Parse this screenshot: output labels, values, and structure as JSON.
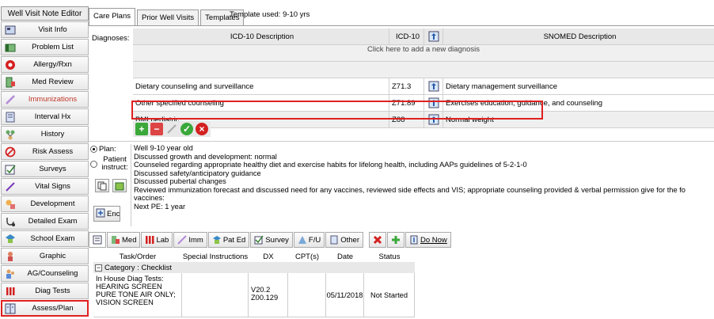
{
  "sidebar": {
    "title": "Well Visit Note Editor",
    "items": [
      {
        "label": "Visit Info",
        "icon": "visit-info-icon",
        "style": "normal"
      },
      {
        "label": "Problem List",
        "icon": "problem-list-icon",
        "style": "normal"
      },
      {
        "label": "Allergy/Rxn",
        "icon": "allergy-icon",
        "style": "normal"
      },
      {
        "label": "Med Review",
        "icon": "med-review-icon",
        "style": "normal"
      },
      {
        "label": "Immunizations",
        "icon": "syringe-icon",
        "style": "red"
      },
      {
        "label": "Interval Hx",
        "icon": "document-icon",
        "style": "normal"
      },
      {
        "label": "History",
        "icon": "family-tree-icon",
        "style": "normal"
      },
      {
        "label": "Risk Assess",
        "icon": "prohibited-icon",
        "style": "normal"
      },
      {
        "label": "Surveys",
        "icon": "survey-icon",
        "style": "normal"
      },
      {
        "label": "Vital Signs",
        "icon": "pencil-icon",
        "style": "normal"
      },
      {
        "label": "Development",
        "icon": "development-icon",
        "style": "normal"
      },
      {
        "label": "Detailed Exam",
        "icon": "stethoscope-icon",
        "style": "normal"
      },
      {
        "label": "School Exam",
        "icon": "school-icon",
        "style": "normal"
      },
      {
        "label": "Graphic",
        "icon": "graphic-icon",
        "style": "normal"
      },
      {
        "label": "AG/Counseling",
        "icon": "counseling-icon",
        "style": "normal"
      },
      {
        "label": "Diag Tests",
        "icon": "test-tubes-icon",
        "style": "normal"
      },
      {
        "label": "Assess/Plan",
        "icon": "assess-plan-icon",
        "style": "normal"
      }
    ]
  },
  "tabs": [
    "Care Plans",
    "Prior Well Visits",
    "Templates"
  ],
  "template_used": "Template used:  9-10 yrs",
  "diagnoses": {
    "label": "Diagnoses:",
    "headers": {
      "desc": "ICD-10 Description",
      "code": "ICD-10",
      "snomed": "SNOMED Description"
    },
    "add_text": "Click here to add a new diagnosis",
    "rows": [
      {
        "desc": "Dietary counseling and surveillance",
        "code": "Z71.3",
        "snomed": "Dietary management surveillance"
      },
      {
        "desc": "Other specified counseling",
        "code": "Z71.89",
        "snomed": "Exercises education, guidance, and counseling"
      },
      {
        "desc": "BMI pediatric",
        "code": "Z68",
        "snomed": "Normal weight"
      }
    ]
  },
  "plan": {
    "radio_plan": "Plan:",
    "radio_patient": "Patient instruct:",
    "enc_label": "Enc",
    "lines": [
      "Well 9-10 year old",
      "Discussed growth and development: normal",
      "Counseled regarding appropriate healthy diet and exercise habits for lifelong health, including AAPs guidelines of 5-2-1-0",
      "Discussed safety/anticipatory guidance",
      "Discussed pubertal changes",
      "Reviewed immunization forecast and discussed need for any vaccines, reviewed side effects and VIS;  appropriate counseling provided & verbal permission give for the fo",
      "vaccines:",
      "Next PE: 1 year"
    ]
  },
  "bottom_tabs": [
    "Med",
    "Lab",
    "Imm",
    "Pat Ed",
    "Survey",
    "F/U",
    "Other"
  ],
  "do_now": "Do Now",
  "orders": {
    "headers": [
      "Task/Order",
      "Special Instructions",
      "DX",
      "CPT(s)",
      "Date",
      "Status"
    ],
    "category": "Category : Checklist",
    "rows": [
      {
        "task": "In House Diag Tests: HEARING SCREEN PURE TONE AIR ONLY; VISION SCREEN",
        "instructions": "",
        "dx1": "V20.2",
        "dx2": "Z00.129",
        "cpt": "",
        "date": "05/11/2018",
        "status": "Not Started"
      }
    ]
  },
  "colors": {
    "highlight": "#e02020",
    "header_bg": "#e8e8e8"
  }
}
